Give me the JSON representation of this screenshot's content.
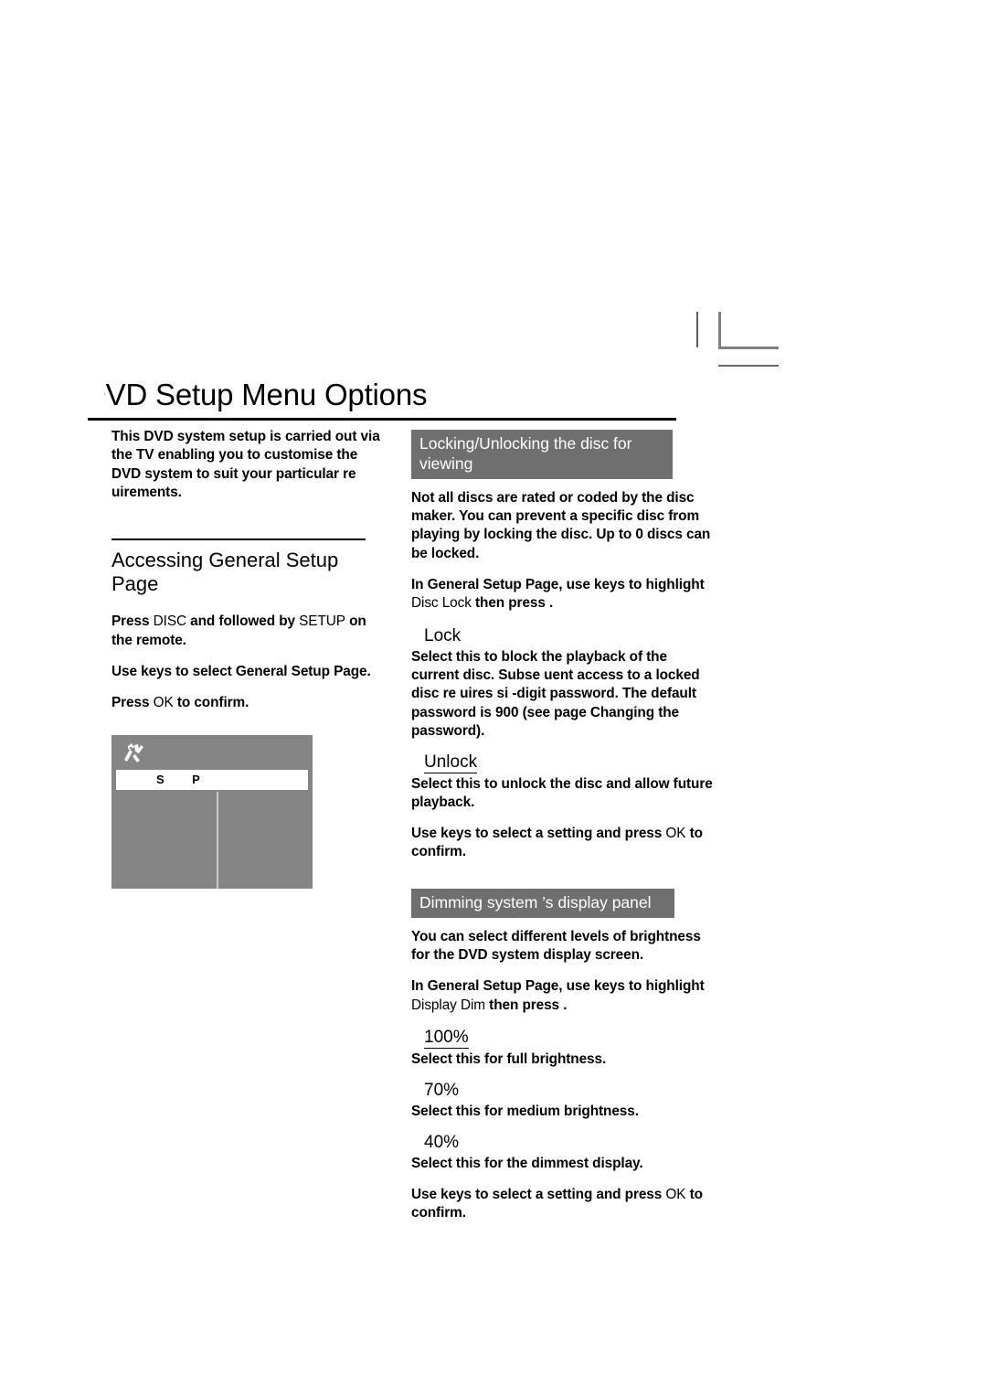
{
  "page": {
    "title": "DVD Setup Menu Options"
  },
  "crop_mark": {
    "name": "registration-crop-mark"
  },
  "left_column": {
    "intro": "This DVD system setup is carried out via the TV enabling you to customise the DVD system to suit your particular re uirements.",
    "section_heading": "Accessing General Setup Page",
    "steps": [
      {
        "id": "step-disc-setup",
        "parts": [
          {
            "text": "Press ",
            "style": "bold"
          },
          {
            "text": "DISC",
            "style": "light"
          },
          {
            "text": " and followed by ",
            "style": "bold"
          },
          {
            "text": "SETUP",
            "style": "light"
          },
          {
            "text": " on the remote.",
            "style": "bold"
          }
        ]
      },
      {
        "id": "step-select-page",
        "parts": [
          {
            "text": "Use ",
            "style": "bold"
          },
          {
            "text": "    ",
            "style": "light"
          },
          {
            "text": "keys to select ",
            "style": "bold"
          },
          {
            "text": "General Setup Page",
            "style": "bold"
          },
          {
            "text": ".",
            "style": "bold"
          }
        ]
      },
      {
        "id": "step-press-ok",
        "parts": [
          {
            "text": "Press ",
            "style": "bold"
          },
          {
            "text": "OK",
            "style": "light"
          },
          {
            "text": " to confirm.",
            "style": "bold"
          }
        ]
      }
    ],
    "osd_screenshot": {
      "icon_name": "setup-tools-icon",
      "menu_tab_letters": [
        "S",
        "P"
      ]
    }
  },
  "right_column": {
    "sections": [
      {
        "id": "locking-unlocking",
        "header": "Locking/Unlocking the disc for viewing",
        "body": "Not all discs are rated or coded by the disc maker. You can prevent a specific disc from playing by locking the disc.  Up to  0 discs can be locked.",
        "instruction_parts": [
          {
            "text": "In General Setup Page",
            "style": "bold"
          },
          {
            "text": ", use ",
            "style": "bold"
          },
          {
            "text": "   ",
            "style": "light"
          },
          {
            "text": "keys to highlight ",
            "style": "bold"
          },
          {
            "text": "Disc Lock",
            "style": "light"
          },
          {
            "text": "   then press ",
            "style": "bold"
          },
          {
            "text": ".",
            "style": "bold"
          }
        ],
        "options": [
          {
            "label": "Lock",
            "underline": false,
            "description": "Select this to block the playback of the current disc. Subse uent access to a locked disc re uires si -digit password. The default password is  900 (see page   Changing the password)."
          },
          {
            "label": "Unlock ",
            "underline": true,
            "description": "Select this to unlock the disc and allow future playback."
          }
        ],
        "footer_parts": [
          {
            "text": "Use ",
            "style": "bold"
          },
          {
            "text": "    ",
            "style": "light"
          },
          {
            "text": "keys to select a setting and press ",
            "style": "bold"
          },
          {
            "text": "OK",
            "style": "light"
          },
          {
            "text": " to confirm.",
            "style": "bold"
          }
        ]
      },
      {
        "id": "dimming-display-panel",
        "header": "Dimming system ’s display panel",
        "body": "You can select different levels of brightness for the DVD system display screen.",
        "instruction_parts": [
          {
            "text": "In General Setup Page",
            "style": "bold"
          },
          {
            "text": ", use ",
            "style": "bold"
          },
          {
            "text": "   ",
            "style": "light"
          },
          {
            "text": "keys to highlight ",
            "style": "bold"
          },
          {
            "text": "Display Dim",
            "style": "light"
          },
          {
            "text": "    then press ",
            "style": "bold"
          },
          {
            "text": ".",
            "style": "bold"
          }
        ],
        "options": [
          {
            "label": "100%",
            "underline": true,
            "description": "Select this for full brightness."
          },
          {
            "label": "70%",
            "underline": false,
            "description": "Select this for medium brightness."
          },
          {
            "label": "40%",
            "underline": false,
            "description": "Select this for the dimmest display."
          }
        ],
        "footer_parts": [
          {
            "text": "Use ",
            "style": "bold"
          },
          {
            "text": "    ",
            "style": "light"
          },
          {
            "text": "keys to select a setting and press ",
            "style": "bold"
          },
          {
            "text": "OK",
            "style": "light"
          },
          {
            "text": " to confirm.",
            "style": "bold"
          }
        ]
      }
    ]
  },
  "colors": {
    "grey_bar": "#6f6f6f",
    "osd_background": "#858585",
    "rule": "#000000"
  }
}
